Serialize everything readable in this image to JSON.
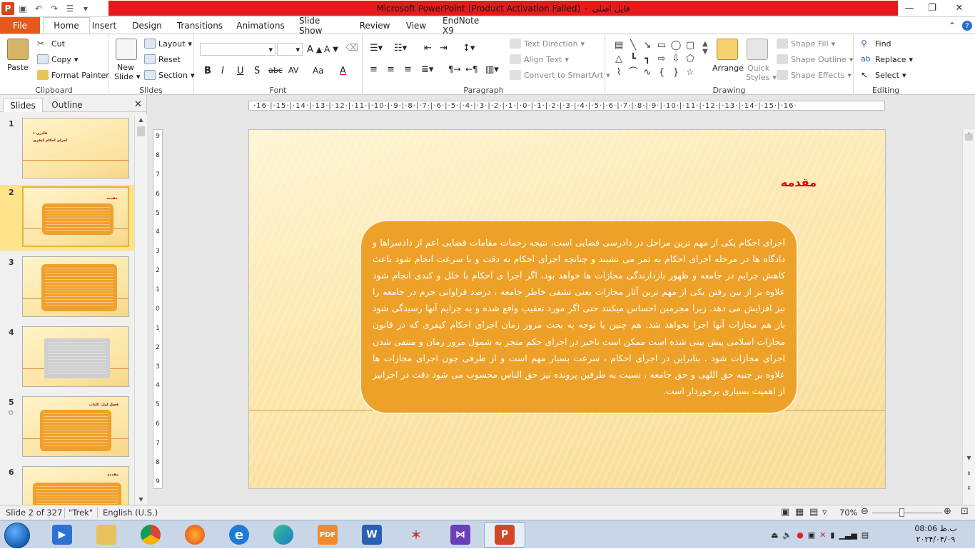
{
  "window": {
    "title": "Microsoft PowerPoint (Product Activation Failed)",
    "doc_name": "فایل اصلی",
    "separator": "-"
  },
  "ribbon_tabs": [
    "File",
    "Home",
    "Insert",
    "Design",
    "Transitions",
    "Animations",
    "Slide Show",
    "Review",
    "View",
    "EndNote X9"
  ],
  "clipboard": {
    "paste": "Paste",
    "cut": "Cut",
    "copy": "Copy",
    "format_painter": "Format Painter",
    "label": "Clipboard"
  },
  "slides_group": {
    "new_slide_line1": "New",
    "new_slide_line2": "Slide",
    "layout": "Layout",
    "reset": "Reset",
    "section": "Section",
    "label": "Slides"
  },
  "font_group": {
    "label": "Font",
    "bold": "B",
    "italic": "I",
    "underline": "U",
    "shadow": "S",
    "strike": "abc",
    "spacing": "AV",
    "case": "Aa",
    "color": "A"
  },
  "paragraph_group": {
    "text_direction": "Text Direction",
    "align_text": "Align Text",
    "convert": "Convert to SmartArt",
    "label": "Paragraph"
  },
  "drawing_group": {
    "arrange": "Arrange",
    "quick_styles_line1": "Quick",
    "quick_styles_line2": "Styles",
    "shape_fill": "Shape Fill",
    "shape_outline": "Shape Outline",
    "shape_effects": "Shape Effects",
    "label": "Drawing"
  },
  "editing_group": {
    "find": "Find",
    "replace": "Replace",
    "select": "Select",
    "label": "Editing"
  },
  "pane": {
    "tab_slides": "Slides",
    "tab_outline": "Outline"
  },
  "thumbnails": [
    {
      "num": "1",
      "title": "قادری ۱",
      "subtitle": "اجرای احکام کیفری"
    },
    {
      "num": "2",
      "title": "مقدمه"
    },
    {
      "num": "3"
    },
    {
      "num": "4"
    },
    {
      "num": "5",
      "title": "فصل اول: کلیات"
    },
    {
      "num": "6",
      "title": "مقدمه"
    }
  ],
  "ruler": {
    "h": "·16·|·15·|·14·|·13·|·12·|·11·|·10·|·9·|·8·|·7·|·6·|·5·|·4·|·3·|·2·|·1·|·0·|·1·|·2·|·3·|·4·|·5·|·6·|·7·|·8·|·9·|·10·|·11·|·12·|·13·|·14·|·15·|·16·",
    "v": [
      "9",
      "8",
      "7",
      "6",
      "5",
      "4",
      "3",
      "2",
      "1",
      "0",
      "1",
      "2",
      "3",
      "4",
      "5",
      "6",
      "7",
      "8",
      "9"
    ]
  },
  "slide": {
    "title": "مقدمه",
    "body": "اجرای احکام یکی از مهم ترین مراحل در دادرسی قضایی است، نتیجه زحمات مقامات قضایی اعم از دادسراها و دادگاه ها در مرحله اجرای احکام به ثمر می نشیند و چنانچه اجرای احکام به دقت و با سرعت انجام شود باعث کاهش جرایم در جامعه و ظهور بازدارندگی مجازات ها خواهد بود، اگر اجرا ی احکام با خلل و کندی انجام شود علاوه بر از بین رفتن یکی از مهم ترین آثار مجازات یعنی تشفی خاطر جامعه ، درصد فراوانی جرم در جامعه را نیز افزایش می دهد. زیرا مجرمین احساس میکنند حتی اگر مورد تعقیب واقع شده و به جرایم آنها رسیدگی شود باز هم مجازات آنها اجرا نخواهد شد. هم چنین با توجه به بحث مرور زمان اجرای احکام کیفری که در قانون مجازات اسلامی پیش بینی شده است ممکن است تاخیر در اجرای حکم منجر به شمول مرور زمان و منتفی شدن اجرای مجازات شود . بنابراین در اجرای احکام ، سرعت بسیار مهم است و از طرفی چون اجرای مجازات ها علاوه بر جنبه حق اللهی و حق جامعه ، نسبت به طرفین پرونده نیز حق الناس محسوب می شود دقت در اجرانیز از اهمیت بسیاری برخوردار است."
  },
  "status": {
    "slide_info": "Slide 2 of 327",
    "theme": "\"Trek\"",
    "language": "English (U.S.)",
    "zoom": "70%",
    "zoom_level": 0.7
  },
  "clock": {
    "time": "08:06 ب.ظ",
    "date": "۲۰۲۴/۰۴/۰۹"
  },
  "colors": {
    "accent": "#e55a1c",
    "title_bar": "#e51a1a",
    "callout": "#eda128",
    "slide_title": "#e00000"
  }
}
